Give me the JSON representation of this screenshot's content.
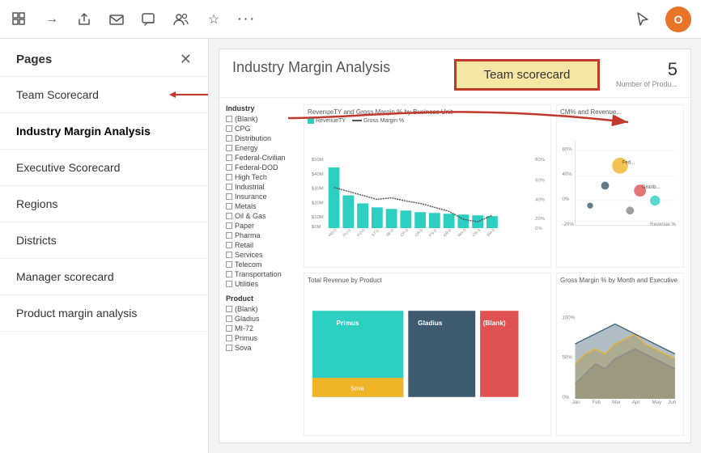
{
  "toolbar": {
    "icons": [
      {
        "name": "grid-icon",
        "symbol": "⊞"
      },
      {
        "name": "arrow-right-icon",
        "symbol": "→"
      },
      {
        "name": "share-icon",
        "symbol": "↗"
      },
      {
        "name": "mail-icon",
        "symbol": "✉"
      },
      {
        "name": "chat-icon",
        "symbol": "💬"
      },
      {
        "name": "teams-icon",
        "symbol": "👥"
      },
      {
        "name": "star-icon",
        "symbol": "☆"
      },
      {
        "name": "more-icon",
        "symbol": "•••"
      }
    ]
  },
  "sidebar": {
    "title": "Pages",
    "items": [
      {
        "id": "team-scorecard",
        "label": "Team Scorecard",
        "active": false,
        "bold": false,
        "has_arrow": true
      },
      {
        "id": "industry-margin",
        "label": "Industry Margin Analysis",
        "active": true,
        "bold": true,
        "has_arrow": false
      },
      {
        "id": "executive-scorecard",
        "label": "Executive Scorecard",
        "active": false,
        "bold": false,
        "has_arrow": false
      },
      {
        "id": "regions",
        "label": "Regions",
        "active": false,
        "bold": false,
        "has_arrow": false
      },
      {
        "id": "districts",
        "label": "Districts",
        "active": false,
        "bold": false,
        "has_arrow": false
      },
      {
        "id": "manager-scorecard",
        "label": "Manager scorecard",
        "active": false,
        "bold": false,
        "has_arrow": false
      },
      {
        "id": "product-margin",
        "label": "Product margin analysis",
        "active": false,
        "bold": false,
        "has_arrow": false
      }
    ]
  },
  "report": {
    "title": "Industry Margin Analysis",
    "team_scorecard_btn": "Team scorecard",
    "number": "5",
    "number_label": "Number of Produ...",
    "chart1_title": "RevenueTY and Gross Margin % by Business Unit",
    "chart2_title": "CM% and Revenue...",
    "chart3_title": "Total Revenue by Product",
    "chart4_title": "Gross Margin % by Month and Executive"
  },
  "filters": {
    "industry_title": "Industry",
    "industry_items": [
      "(Blank)",
      "CPG",
      "Distribution",
      "Energy",
      "Federal-Civilian",
      "Federal-DOD",
      "High Tech",
      "Industrial",
      "Insurance",
      "Metals",
      "Oil & Gas",
      "Paper",
      "Pharma",
      "Retail",
      "Services",
      "Telecom",
      "Transportation",
      "Utilities"
    ],
    "product_title": "Product",
    "product_items": [
      "(Blank)",
      "Gladius",
      "MI-72",
      "Primus",
      "Sova"
    ]
  },
  "colors": {
    "active_sidebar": "#000000",
    "arrow_color": "#c0392b",
    "highlight_border": "#c0392b",
    "btn_bg": "#f5e6a3",
    "teal": "#2dcfc0",
    "dark_blue_gray": "#3d5a6e",
    "red_chart": "#e05252",
    "yellow": "#f0b429"
  }
}
